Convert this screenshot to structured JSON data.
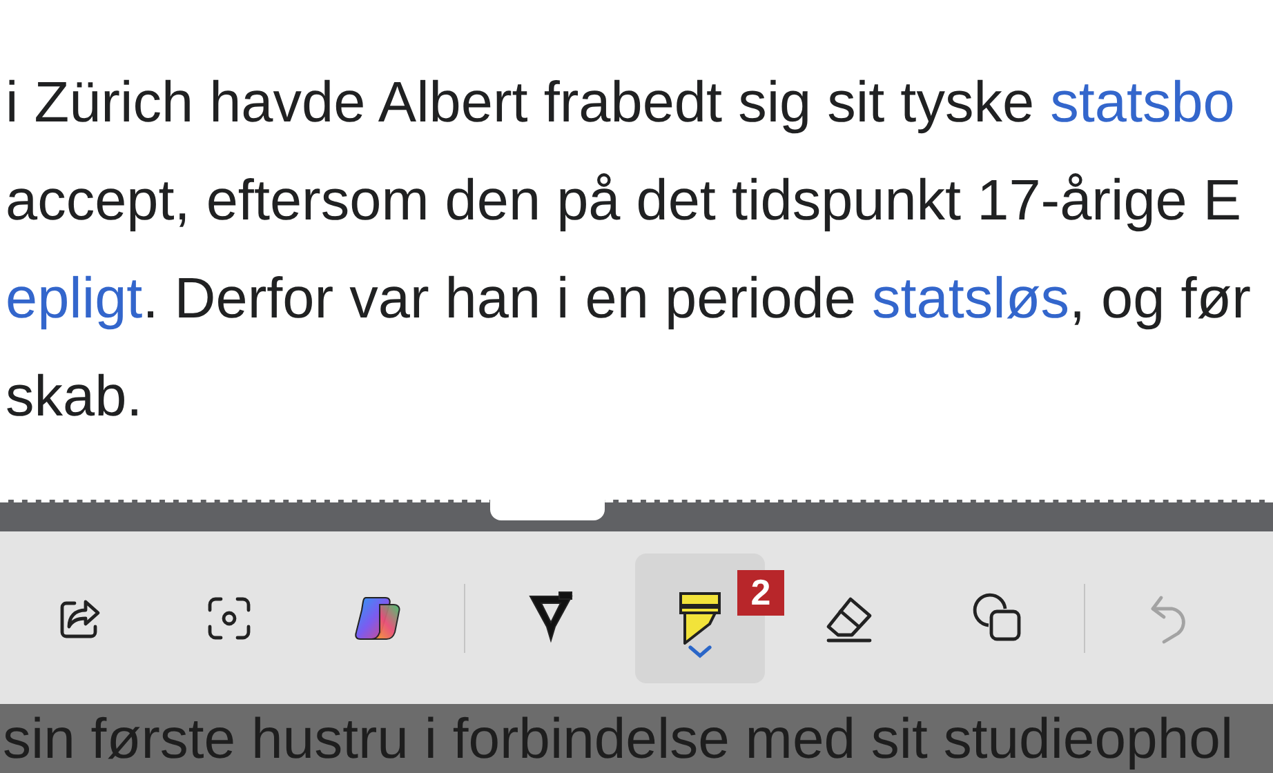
{
  "document": {
    "lines": [
      [
        {
          "kind": "text",
          "text": "i Zürich havde Albert frabedt sig sit tyske "
        },
        {
          "kind": "link",
          "text": "statsbo"
        }
      ],
      [
        {
          "kind": "text",
          "text": "accept, eftersom den på det tidspunkt 17-årige E"
        }
      ],
      [
        {
          "kind": "link",
          "text": "epligt"
        },
        {
          "kind": "text",
          "text": ". Derfor var han i en periode "
        },
        {
          "kind": "link",
          "text": "statsløs"
        },
        {
          "kind": "text",
          "text": ", og før"
        }
      ],
      [
        {
          "kind": "text",
          "text": "skab."
        }
      ]
    ]
  },
  "toolbar": {
    "tools": [
      {
        "kind": "share",
        "selected": false,
        "disabled": false
      },
      {
        "kind": "capture",
        "selected": false,
        "disabled": false
      },
      {
        "kind": "copilot",
        "selected": false,
        "disabled": false
      },
      {
        "kind": "divider"
      },
      {
        "kind": "pen",
        "selected": false,
        "disabled": false
      },
      {
        "kind": "highlighter",
        "selected": true,
        "disabled": false,
        "badge": "2"
      },
      {
        "kind": "eraser",
        "selected": false,
        "disabled": false
      },
      {
        "kind": "shapes",
        "selected": false,
        "disabled": false
      },
      {
        "kind": "divider"
      },
      {
        "kind": "undo",
        "selected": false,
        "disabled": true
      }
    ]
  },
  "background_text": "sin første hustru i forbindelse med sit studieophol"
}
